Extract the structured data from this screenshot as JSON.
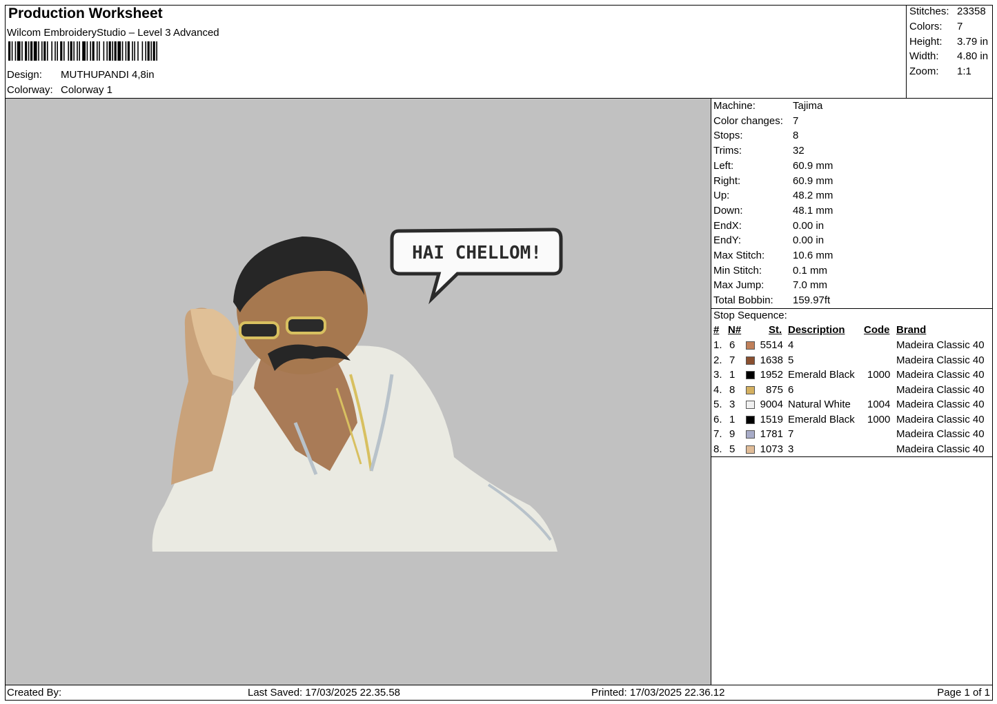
{
  "header": {
    "title": "Production Worksheet",
    "software": "Wilcom EmbroideryStudio – Level 3 Advanced",
    "design_label": "Design:",
    "design_value": "MUTHUPANDI 4,8in",
    "colorway_label": "Colorway:",
    "colorway_value": "Colorway 1"
  },
  "summary": [
    {
      "label": "Stitches:",
      "value": "23358"
    },
    {
      "label": "Colors:",
      "value": "7"
    },
    {
      "label": "Height:",
      "value": "3.79 in"
    },
    {
      "label": "Width:",
      "value": "4.80 in"
    },
    {
      "label": "Zoom:",
      "value": "1:1"
    }
  ],
  "design_preview": {
    "speech_text": "HAI CHELLOM!",
    "background": "#c1c1c1"
  },
  "machine_info": [
    {
      "label": "Machine:",
      "value": "Tajima"
    },
    {
      "label": "Color changes:",
      "value": "7"
    },
    {
      "label": "Stops:",
      "value": "8"
    },
    {
      "label": "Trims:",
      "value": "32"
    },
    {
      "label": "Left:",
      "value": "60.9 mm"
    },
    {
      "label": "Right:",
      "value": "60.9 mm"
    },
    {
      "label": "Up:",
      "value": "48.2 mm"
    },
    {
      "label": "Down:",
      "value": "48.1 mm"
    },
    {
      "label": "EndX:",
      "value": "0.00 in"
    },
    {
      "label": "EndY:",
      "value": "0.00 in"
    },
    {
      "label": "Max Stitch:",
      "value": "10.6 mm"
    },
    {
      "label": "Min Stitch:",
      "value": "0.1 mm"
    },
    {
      "label": "Max Jump:",
      "value": "7.0 mm"
    },
    {
      "label": "Total Bobbin:",
      "value": "159.97ft"
    }
  ],
  "stop_sequence": {
    "title": "Stop Sequence:",
    "headers": {
      "index": "#",
      "needle": "N#",
      "st": "St.",
      "description": "Description",
      "code": "Code",
      "brand": "Brand"
    },
    "rows": [
      {
        "index": "1.",
        "needle": "6",
        "color": "#c0805a",
        "st": "5514",
        "description": "4",
        "code": "",
        "brand": "Madeira Classic 40"
      },
      {
        "index": "2.",
        "needle": "7",
        "color": "#8a5030",
        "st": "1638",
        "description": "5",
        "code": "",
        "brand": "Madeira Classic 40"
      },
      {
        "index": "3.",
        "needle": "1",
        "color": "#000000",
        "st": "1952",
        "description": "Emerald Black",
        "code": "1000",
        "brand": "Madeira Classic 40"
      },
      {
        "index": "4.",
        "needle": "8",
        "color": "#d4b060",
        "st": "875",
        "description": "6",
        "code": "",
        "brand": "Madeira Classic 40"
      },
      {
        "index": "5.",
        "needle": "3",
        "color": "#f0f0f0",
        "st": "9004",
        "description": "Natural White",
        "code": "1004",
        "brand": "Madeira Classic 40"
      },
      {
        "index": "6.",
        "needle": "1",
        "color": "#000000",
        "st": "1519",
        "description": "Emerald Black",
        "code": "1000",
        "brand": "Madeira Classic 40"
      },
      {
        "index": "7.",
        "needle": "9",
        "color": "#a8acc8",
        "st": "1781",
        "description": "7",
        "code": "",
        "brand": "Madeira Classic 40"
      },
      {
        "index": "8.",
        "needle": "5",
        "color": "#e0bc98",
        "st": "1073",
        "description": "3",
        "code": "",
        "brand": "Madeira Classic 40"
      }
    ]
  },
  "footer": {
    "created_by": "Created By:",
    "last_saved": "Last Saved: 17/03/2025 22.35.58",
    "printed": "Printed: 17/03/2025 22.36.12",
    "page": "Page 1 of 1"
  }
}
